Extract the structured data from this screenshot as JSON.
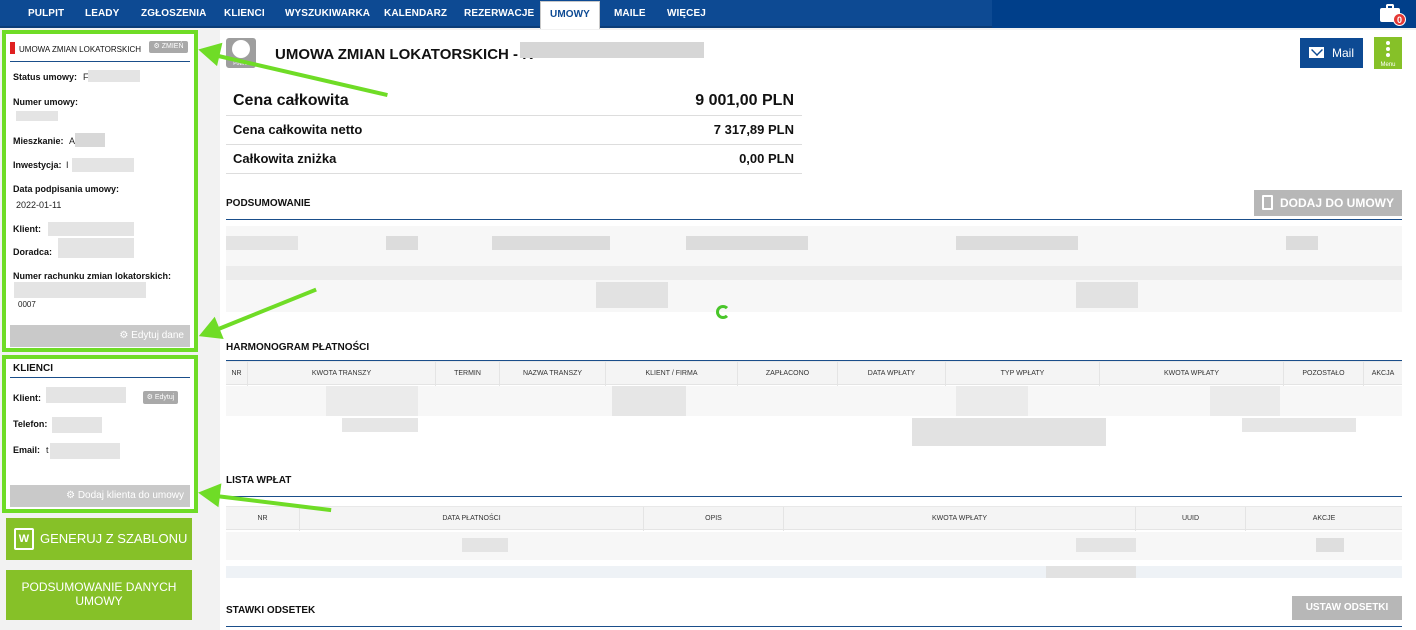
{
  "nav": {
    "items": [
      "PULPIT",
      "LEADY",
      "ZGŁOSZENIA",
      "KLIENCI",
      "WYSZUKIWARKA",
      "KALENDARZ",
      "REZERWACJE",
      "UMOWY",
      "MAILE",
      "WIĘCEJ"
    ],
    "active": "UMOWY",
    "notification_count": "0"
  },
  "contract_panel": {
    "title": "UMOWA ZMIAN LOKATORSKICH",
    "change_button": "ZMIEŃ",
    "status_label": "Status umowy:",
    "status_value": "F",
    "number_label": "Numer umowy:",
    "apartment_label": "Mieszkanie:",
    "apartment_value": "A",
    "investment_label": "Inwestycja:",
    "investment_value": "I",
    "signed_label": "Data podpisania umowy:",
    "signed_value": "2022-01-11",
    "client_label": "Klient:",
    "advisor_label": "Doradca:",
    "account_label": "Numer rachunku zmian lokatorskich:",
    "account_value": "0007",
    "edit_button": "Edytuj dane"
  },
  "clients_panel": {
    "title": "KLIENCI",
    "client_label": "Klient:",
    "edit_button": "Edytuj",
    "phone_label": "Telefon:",
    "email_label": "Email:",
    "email_value": "t",
    "add_button": "Dodaj klienta do umowy"
  },
  "actions": {
    "generate": "GENERUJ Z SZABLONU",
    "summary_line1": "PODSUMOWANIE DANYCH",
    "summary_line2": "UMOWY"
  },
  "header": {
    "back_label": "Powrót",
    "title": "UMOWA ZMIAN LOKATORSKICH - K",
    "mail_button": "Mail",
    "menu_button": "Menu"
  },
  "prices": [
    {
      "label": "Cena całkowita",
      "value": "9 001,00 PLN"
    },
    {
      "label": "Cena całkowita netto",
      "value": "7 317,89 PLN"
    },
    {
      "label": "Całkowita zniżka",
      "value": "0,00 PLN"
    }
  ],
  "summary": {
    "title": "PODSUMOWANIE",
    "add_button": "DODAJ DO UMOWY"
  },
  "schedule": {
    "title": "HARMONOGRAM PŁATNOŚCI",
    "columns": [
      "NR",
      "KWOTA TRANSZY",
      "TERMIN",
      "NAZWA TRANSZY",
      "KLIENT / FIRMA",
      "ZAPŁACONO",
      "DATA WPŁATY",
      "TYP WPŁATY",
      "KWOTA WPŁATY",
      "POZOSTAŁO",
      "AKCJA"
    ]
  },
  "payments": {
    "title": "LISTA WPŁAT",
    "columns": [
      "NR",
      "DATA PŁATNOŚCI",
      "OPIS",
      "KWOTA WPŁATY",
      "UUID",
      "AKCJE"
    ]
  },
  "interest": {
    "title": "STAWKI ODSETEK",
    "set_button": "USTAW ODSETKI"
  },
  "colors": {
    "nav": "#0d4a93",
    "green": "#86c128",
    "highlight": "#6fdc26",
    "gray_button": "#b7b7b7"
  }
}
